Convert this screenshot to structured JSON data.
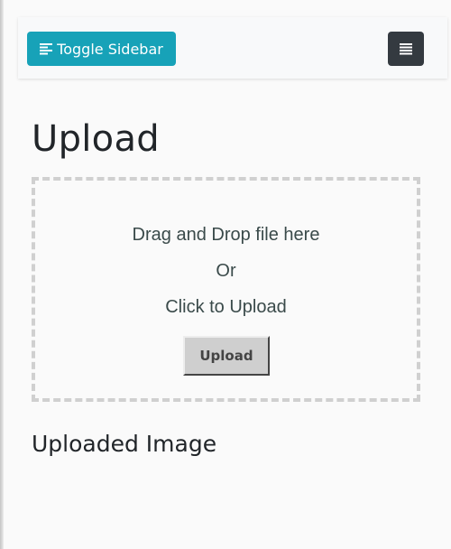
{
  "navbar": {
    "toggle_label": "Toggle Sidebar",
    "toggle_icon": "align-left-icon",
    "menu_icon": "hamburger-menu-icon",
    "toggle_color": "#17a2b8",
    "menu_button_color": "#343a40"
  },
  "main": {
    "title": "Upload",
    "dropzone": {
      "line1": "Drag and Drop file here",
      "line2": "Or",
      "line3": "Click to Upload",
      "button_label": "Upload"
    },
    "uploaded_heading": "Uploaded Image"
  }
}
